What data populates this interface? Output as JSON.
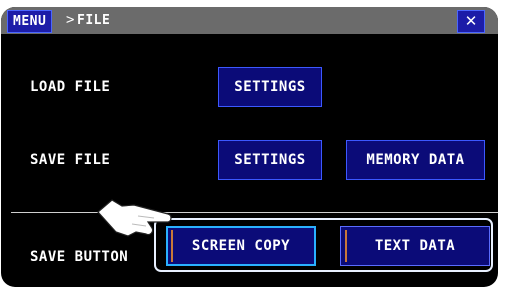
{
  "titlebar": {
    "menu_label": "MENU",
    "separator": ">",
    "crumb": "FILE",
    "close_symbol": "✕"
  },
  "rows": {
    "load_file": {
      "label": "LOAD FILE",
      "buttons": [
        "SETTINGS"
      ]
    },
    "save_file": {
      "label": "SAVE FILE",
      "buttons": [
        "SETTINGS",
        "MEMORY DATA"
      ]
    },
    "save_button": {
      "label": "SAVE BUTTON",
      "options": [
        "SCREEN COPY",
        "TEXT DATA"
      ],
      "selected": "SCREEN COPY"
    }
  },
  "icons": {
    "pointer": "pointing-hand-icon",
    "close": "close-icon"
  },
  "colors": {
    "accent": "#1c1ca8",
    "button_fill": "#0b0b78",
    "button_border": "#3c58ff",
    "selected_border": "#2ab0ff",
    "titlebar": "#6b6b6b",
    "background": "#000000"
  }
}
